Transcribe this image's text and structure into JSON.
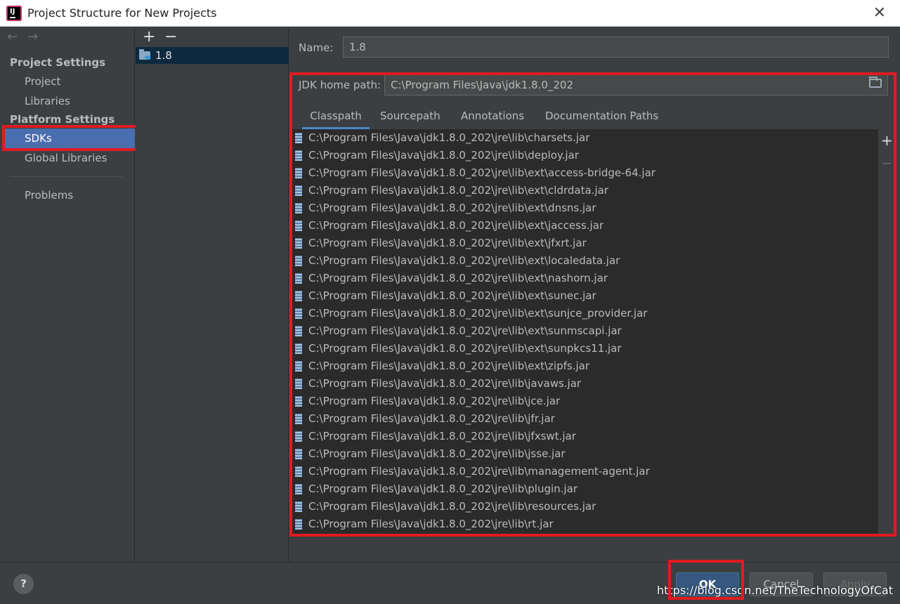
{
  "window": {
    "title": "Project Structure for New Projects",
    "close_glyph": "✕"
  },
  "nav": {
    "back": "←",
    "forward": "→"
  },
  "sidebar": {
    "project_settings_header": "Project Settings",
    "platform_settings_header": "Platform Settings",
    "items": [
      {
        "label": "Project"
      },
      {
        "label": "Libraries"
      },
      {
        "label": "SDKs"
      },
      {
        "label": "Global Libraries"
      },
      {
        "label": "Problems"
      }
    ],
    "selected": "SDKs"
  },
  "sdk_list": {
    "add": "+",
    "remove": "−",
    "items": [
      {
        "label": "1.8"
      }
    ]
  },
  "detail": {
    "name_label": "Name:",
    "name_value": "1.8",
    "jdk_home_label": "JDK home path:",
    "jdk_home_value": "C:\\Program Files\\Java\\jdk1.8.0_202",
    "tabs": [
      "Classpath",
      "Sourcepath",
      "Annotations",
      "Documentation Paths"
    ],
    "active_tab": "Classpath",
    "add": "+",
    "remove": "−",
    "paths": [
      "C:\\Program Files\\Java\\jdk1.8.0_202\\jre\\lib\\charsets.jar",
      "C:\\Program Files\\Java\\jdk1.8.0_202\\jre\\lib\\deploy.jar",
      "C:\\Program Files\\Java\\jdk1.8.0_202\\jre\\lib\\ext\\access-bridge-64.jar",
      "C:\\Program Files\\Java\\jdk1.8.0_202\\jre\\lib\\ext\\cldrdata.jar",
      "C:\\Program Files\\Java\\jdk1.8.0_202\\jre\\lib\\ext\\dnsns.jar",
      "C:\\Program Files\\Java\\jdk1.8.0_202\\jre\\lib\\ext\\jaccess.jar",
      "C:\\Program Files\\Java\\jdk1.8.0_202\\jre\\lib\\ext\\jfxrt.jar",
      "C:\\Program Files\\Java\\jdk1.8.0_202\\jre\\lib\\ext\\localedata.jar",
      "C:\\Program Files\\Java\\jdk1.8.0_202\\jre\\lib\\ext\\nashorn.jar",
      "C:\\Program Files\\Java\\jdk1.8.0_202\\jre\\lib\\ext\\sunec.jar",
      "C:\\Program Files\\Java\\jdk1.8.0_202\\jre\\lib\\ext\\sunjce_provider.jar",
      "C:\\Program Files\\Java\\jdk1.8.0_202\\jre\\lib\\ext\\sunmscapi.jar",
      "C:\\Program Files\\Java\\jdk1.8.0_202\\jre\\lib\\ext\\sunpkcs11.jar",
      "C:\\Program Files\\Java\\jdk1.8.0_202\\jre\\lib\\ext\\zipfs.jar",
      "C:\\Program Files\\Java\\jdk1.8.0_202\\jre\\lib\\javaws.jar",
      "C:\\Program Files\\Java\\jdk1.8.0_202\\jre\\lib\\jce.jar",
      "C:\\Program Files\\Java\\jdk1.8.0_202\\jre\\lib\\jfr.jar",
      "C:\\Program Files\\Java\\jdk1.8.0_202\\jre\\lib\\jfxswt.jar",
      "C:\\Program Files\\Java\\jdk1.8.0_202\\jre\\lib\\jsse.jar",
      "C:\\Program Files\\Java\\jdk1.8.0_202\\jre\\lib\\management-agent.jar",
      "C:\\Program Files\\Java\\jdk1.8.0_202\\jre\\lib\\plugin.jar",
      "C:\\Program Files\\Java\\jdk1.8.0_202\\jre\\lib\\resources.jar",
      "C:\\Program Files\\Java\\jdk1.8.0_202\\jre\\lib\\rt.jar"
    ]
  },
  "buttons": {
    "help": "?",
    "ok": "OK",
    "cancel": "Cancel",
    "apply": "Apply"
  },
  "watermark": "https://blog.csdn.net/TheTechnologyOfCat",
  "colors": {
    "accent": "#4b6eaf",
    "highlight_box": "#e11b22",
    "background": "#3c3f41"
  }
}
